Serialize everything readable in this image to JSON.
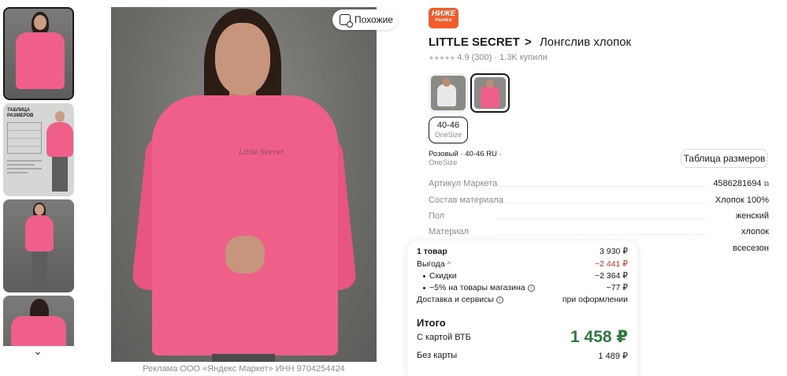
{
  "gallery": {
    "similar_label": "Похожие",
    "size_chart_thumb_title": "ТАБЛИЦА\nРАЗМЕРОВ",
    "ad_note": "Реклама ООО «Яндекс Маркет» ИНН 9704254424"
  },
  "badge": {
    "line1": "НИЖЕ",
    "line2": "РЫНКА"
  },
  "product": {
    "brand": "LITTLE SECRET",
    "chevron": ">",
    "name": "Лонгслив хлопок",
    "shirt_print": "Little Secret",
    "rating": "4.9",
    "reviews": "(300)",
    "separator": "·",
    "bought": "1.3K купили"
  },
  "variants": {
    "size_main": "40-46",
    "size_sub": "OneSize",
    "selected_desc": "Розовый · 40-46 RU ·",
    "selected_desc_sub": "OneSize",
    "size_table_button": "Таблица размеров"
  },
  "specs": [
    {
      "key": "Артикул Маркета",
      "value": "4586281694"
    },
    {
      "key": "Состав материала",
      "value": "Хлопок 100%"
    },
    {
      "key": "Пол",
      "value": "женский"
    },
    {
      "key": "Материал",
      "value": "хлопок"
    },
    {
      "key": "",
      "value": "всесезон"
    }
  ],
  "price_card": {
    "items_label": "1 товар",
    "items_value": "3 930 ₽",
    "benefit_label": "Выгода",
    "benefit_chevron": "^",
    "benefit_value": "−2 441 ₽",
    "discounts_label": "Скидки",
    "discounts_value": "−2 364 ₽",
    "store_label": "−5% на товары магазина",
    "store_value": "−77 ₽",
    "delivery_label": "Доставка и сервисы",
    "delivery_value": "при оформлении",
    "info_glyph": "i",
    "total_label": "Итого",
    "vtb_label": "С картой ВТБ",
    "vtb_value": "1 458 ₽",
    "no_card_label": "Без карты",
    "no_card_value": "1 489 ₽"
  },
  "colors": {
    "accent_orange": "#f25b2a",
    "price_green": "#2f7a3f",
    "discount_red": "#e0321f",
    "product_pink": "#ee5f8a"
  }
}
